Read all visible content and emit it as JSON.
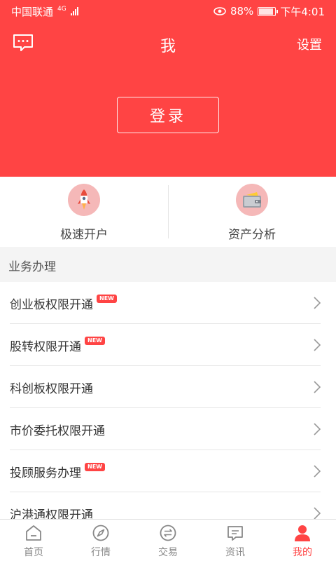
{
  "status": {
    "carrier": "中国联通",
    "network": "4G",
    "battery": "88%",
    "time": "下午4:01",
    "eye_icon": "eye-icon",
    "battery_icon": "battery-icon"
  },
  "header": {
    "title": "我",
    "settings_label": "设置",
    "login_label": "登录",
    "message_icon": "message-icon",
    "bg_color": "#ff4444"
  },
  "quick": [
    {
      "label": "极速开户",
      "icon": "rocket-icon"
    },
    {
      "label": "资产分析",
      "icon": "wallet-icon"
    }
  ],
  "section": {
    "title": "业务办理"
  },
  "list": [
    {
      "label": "创业板权限开通",
      "badge": "NEW"
    },
    {
      "label": "股转权限开通",
      "badge": "NEW"
    },
    {
      "label": "科创板权限开通",
      "badge": ""
    },
    {
      "label": "市价委托权限开通",
      "badge": ""
    },
    {
      "label": "投顾服务办理",
      "badge": "NEW"
    },
    {
      "label": "沪港通权限开通",
      "badge": ""
    }
  ],
  "tabs": [
    {
      "label": "首页",
      "icon": "home-icon",
      "active": false
    },
    {
      "label": "行情",
      "icon": "compass-icon",
      "active": false
    },
    {
      "label": "交易",
      "icon": "exchange-icon",
      "active": false
    },
    {
      "label": "资讯",
      "icon": "news-icon",
      "active": false
    },
    {
      "label": "我的",
      "icon": "user-icon",
      "active": true
    }
  ],
  "colors": {
    "accent": "#ff4444",
    "inactive": "#888888"
  }
}
